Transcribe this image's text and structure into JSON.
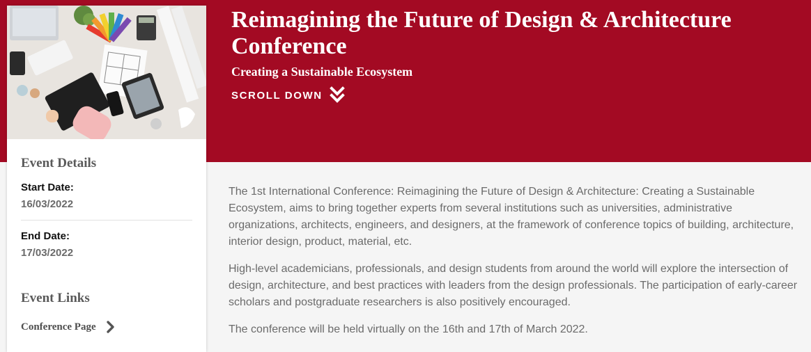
{
  "hero": {
    "title": "Reimagining the Future of Design & Architecture Conference",
    "subtitle": "Creating a Sustainable Ecosystem",
    "scroll_label": "SCROLL DOWN",
    "scroll_icon": "double-chevron-down-icon",
    "image_icon": "design-workspace-image"
  },
  "sidebar": {
    "details_heading": "Event Details",
    "start_label": "Start Date:",
    "start_value": "16/03/2022",
    "end_label": "End Date:",
    "end_value": "17/03/2022",
    "links_heading": "Event Links",
    "links": [
      {
        "label": "Conference Page",
        "icon": "chevron-right-icon"
      }
    ]
  },
  "main": {
    "paragraphs": [
      "The 1st International Conference: Reimagining the Future of Design & Architecture: Creating a Sustainable Ecosystem, aims to bring together experts from several institutions such as universities, administrative organizations, architects, engineers, and designers, at the framework of conference topics of building, architecture, interior design, product, material, etc.",
      "High-level academicians, professionals, and design students from around the world will explore the intersection of design, architecture, and best practices with leaders from the design professionals. The participation of early-career scholars and postgraduate researchers is also positively encouraged.",
      "The conference will be held virtually on the 16th and 17th of March 2022."
    ]
  },
  "colors": {
    "brand_red": "#a30a23",
    "page_background": "#f5f5f5",
    "body_text": "#6b6b6b"
  }
}
